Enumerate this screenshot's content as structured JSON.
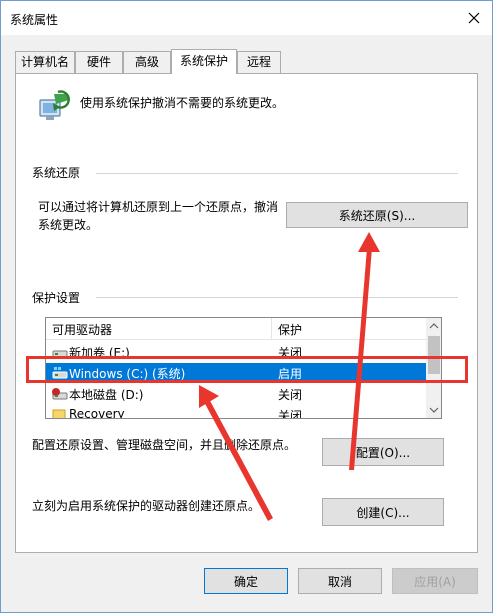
{
  "window": {
    "title": "系统属性",
    "close_label": "×"
  },
  "tabs": [
    {
      "label": "计算机名"
    },
    {
      "label": "硬件"
    },
    {
      "label": "高级"
    },
    {
      "label": "系统保护",
      "active": true
    },
    {
      "label": "远程"
    }
  ],
  "intro": {
    "text": "使用系统保护撤消不需要的系统更改。"
  },
  "restore": {
    "group_label": "系统还原",
    "description_line1": "可以通过将计算机还原到上一个还原点，撤消",
    "description_line2": "系统更改。",
    "button_label": "系统还原(S)..."
  },
  "protection": {
    "group_label": "保护设置",
    "columns": [
      "可用驱动器",
      "保护"
    ],
    "drives": [
      {
        "name": "新加卷 (E:)",
        "status": "关闭",
        "icon": "drive-icon"
      },
      {
        "name": "Windows (C:) (系统)",
        "status": "启用",
        "icon": "system-drive-icon",
        "selected": true
      },
      {
        "name": "本地磁盘 (D:)",
        "status": "关闭",
        "icon": "drive-icon"
      },
      {
        "name": "Recovery",
        "status": "关闭",
        "icon": "folder-icon"
      }
    ],
    "configure_text": "配置还原设置、管理磁盘空间，并且删除还原点。",
    "configure_button": "配置(O)...",
    "create_text": "立刻为启用系统保护的驱动器创建还原点。",
    "create_button": "创建(C)..."
  },
  "footer": {
    "ok": "确定",
    "cancel": "取消",
    "apply": "应用(A)"
  },
  "colors": {
    "selection": "#0078d7",
    "annotation": "#e8352e"
  }
}
